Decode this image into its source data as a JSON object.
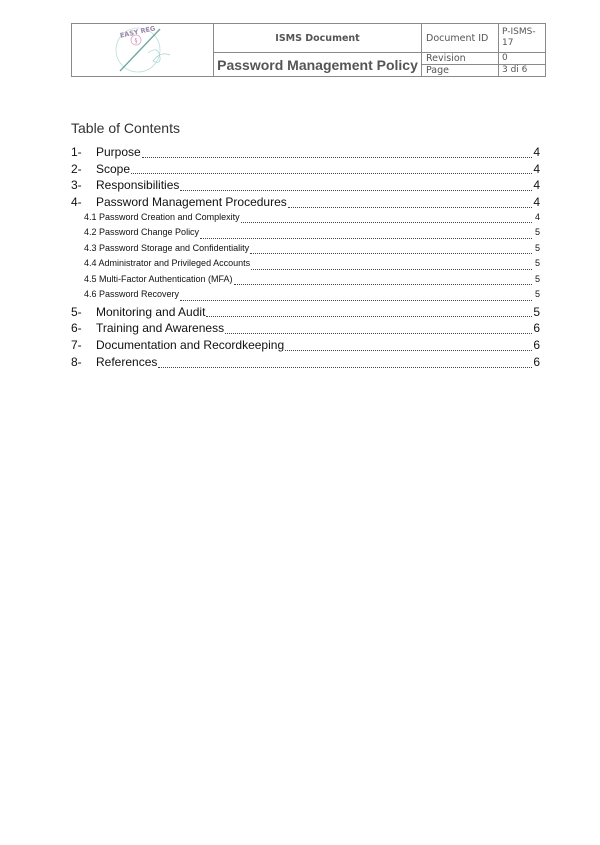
{
  "header": {
    "logo_text": "EASY REG",
    "doc_type": "ISMS Document",
    "doc_title": "Password Management Policy",
    "fields": [
      {
        "label": "Document ID",
        "value": "P-ISMS-17"
      },
      {
        "label": "Revision",
        "value": "0"
      },
      {
        "label": "Page",
        "value": "3 di 6"
      }
    ]
  },
  "toc": {
    "title": "Table of Contents",
    "entries": [
      {
        "num": "1-",
        "label": "Purpose",
        "page": "4",
        "level": 1
      },
      {
        "num": "2-",
        "label": "Scope",
        "page": "4",
        "level": 1
      },
      {
        "num": "3-",
        "label": "Responsibilities",
        "page": "4",
        "level": 1
      },
      {
        "num": "4-",
        "label": "Password Management Procedures",
        "page": "4",
        "level": 1
      },
      {
        "num": "",
        "label": "4.1 Password Creation and Complexity",
        "page": "4",
        "level": 2
      },
      {
        "num": "",
        "label": "4.2 Password Change Policy",
        "page": "5",
        "level": 2
      },
      {
        "num": "",
        "label": "4.3 Password Storage and Confidentiality",
        "page": "5",
        "level": 2
      },
      {
        "num": "",
        "label": "4.4 Administrator and Privileged Accounts",
        "page": "5",
        "level": 2
      },
      {
        "num": "",
        "label": "4.5 Multi-Factor Authentication (MFA)",
        "page": "5",
        "level": 2
      },
      {
        "num": "",
        "label": "4.6 Password Recovery",
        "page": "5",
        "level": 2
      },
      {
        "num": "5-",
        "label": "Monitoring and Audit",
        "page": "5",
        "level": 1
      },
      {
        "num": "6-",
        "label": "Training and Awareness",
        "page": "6",
        "level": 1
      },
      {
        "num": "7-",
        "label": "Documentation and Recordkeeping",
        "page": "6",
        "level": 1
      },
      {
        "num": "8-",
        "label": "References",
        "page": "6",
        "level": 1
      }
    ]
  }
}
